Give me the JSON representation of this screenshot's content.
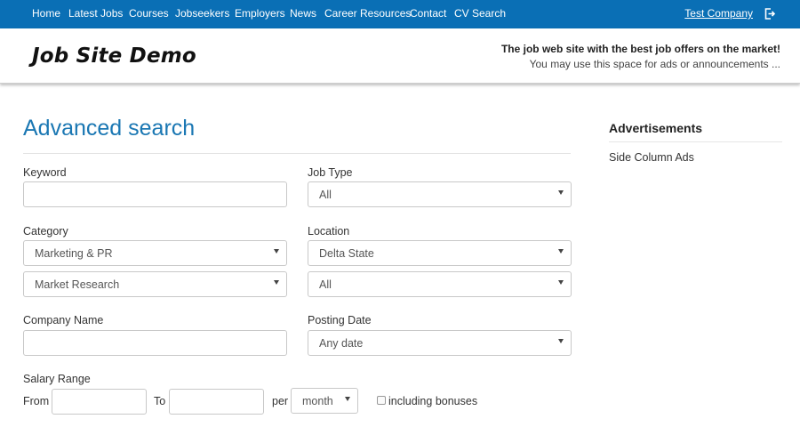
{
  "nav": {
    "items": [
      "Home",
      "Latest Jobs",
      "Courses",
      "Jobseekers",
      "Employers",
      "News",
      "Career Resources",
      "Contact",
      "CV Search"
    ],
    "user_link": "Test Company",
    "logout_icon": "logout-icon"
  },
  "header": {
    "logo": "Job Site Demo",
    "tagline": "The job web site with the best job offers on the market!",
    "announcement": "You may use this space for ads or announcements ..."
  },
  "search": {
    "title": "Advanced search",
    "keyword": {
      "label": "Keyword",
      "value": ""
    },
    "job_type": {
      "label": "Job Type",
      "value": "All"
    },
    "category": {
      "label": "Category",
      "value": "Marketing & PR",
      "sub_value": "Market Research"
    },
    "location": {
      "label": "Location",
      "value": "Delta State",
      "sub_value": "All"
    },
    "company": {
      "label": "Company Name",
      "value": ""
    },
    "posting_date": {
      "label": "Posting Date",
      "value": "Any date"
    },
    "salary": {
      "label": "Salary Range",
      "from_label": "From",
      "to_label": "To",
      "per_label": "per",
      "period_value": "month",
      "bonus_label": "including bonuses",
      "bonus_checked": false
    }
  },
  "sidebar": {
    "title": "Advertisements",
    "text": "Side Column Ads"
  },
  "colors": {
    "nav_bg": "#0a6fb5",
    "title_blue": "#1a77b3"
  }
}
